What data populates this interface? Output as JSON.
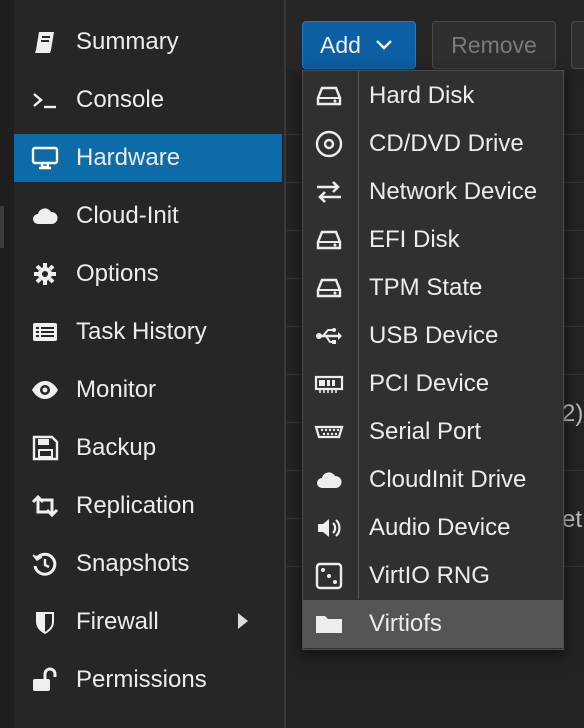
{
  "sidebar": {
    "items": [
      {
        "label": "Summary",
        "icon": "book-icon"
      },
      {
        "label": "Console",
        "icon": "terminal-icon"
      },
      {
        "label": "Hardware",
        "icon": "desktop-icon",
        "active": true
      },
      {
        "label": "Cloud-Init",
        "icon": "cloud-icon"
      },
      {
        "label": "Options",
        "icon": "gear-icon"
      },
      {
        "label": "Task History",
        "icon": "list-icon"
      },
      {
        "label": "Monitor",
        "icon": "eye-icon"
      },
      {
        "label": "Backup",
        "icon": "floppy-icon"
      },
      {
        "label": "Replication",
        "icon": "retweet-icon"
      },
      {
        "label": "Snapshots",
        "icon": "history-icon"
      },
      {
        "label": "Firewall",
        "icon": "shield-icon"
      },
      {
        "label": "Permissions",
        "icon": "unlock-icon"
      }
    ]
  },
  "toolbar": {
    "add_label": "Add",
    "remove_label": "Remove"
  },
  "add_menu": {
    "items": [
      {
        "label": "Hard Disk",
        "icon": "hdd-icon"
      },
      {
        "label": "CD/DVD Drive",
        "icon": "optical-disc-icon"
      },
      {
        "label": "Network Device",
        "icon": "exchange-icon"
      },
      {
        "label": "EFI Disk",
        "icon": "hdd-icon"
      },
      {
        "label": "TPM State",
        "icon": "hdd-icon"
      },
      {
        "label": "USB Device",
        "icon": "usb-icon"
      },
      {
        "label": "PCI Device",
        "icon": "pci-card-icon"
      },
      {
        "label": "Serial Port",
        "icon": "serial-port-icon"
      },
      {
        "label": "CloudInit Drive",
        "icon": "cloud-icon"
      },
      {
        "label": "Audio Device",
        "icon": "volume-icon"
      },
      {
        "label": "VirtIO RNG",
        "icon": "dice-icon"
      },
      {
        "label": "Virtiofs",
        "icon": "folder-icon",
        "highlighted": true
      }
    ]
  },
  "background": {
    "frag_row8": "2)",
    "frag_row10": "et"
  },
  "colors": {
    "accent": "#0d6ba8",
    "menu_bg": "#303030",
    "menu_highlight": "#555555"
  }
}
